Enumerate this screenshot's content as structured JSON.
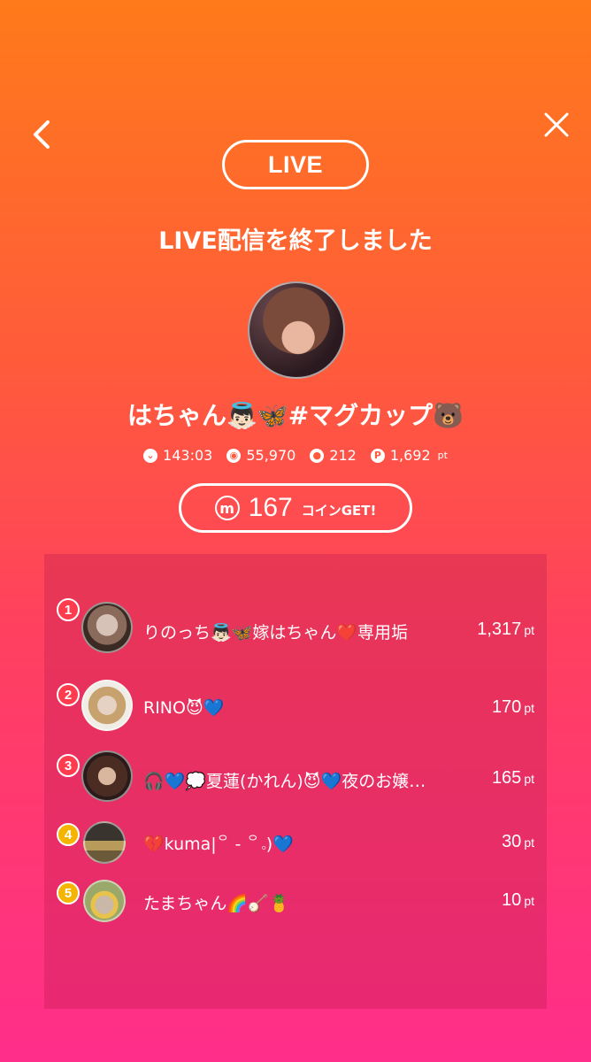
{
  "nav": {
    "back_icon": "chevron-left-icon",
    "close_icon": "close-icon"
  },
  "live_badge": "LIVE",
  "title": "LIVE配信を終了しました",
  "streamer": {
    "name": "はちゃん👼🏻🦋#マグカップ🐻"
  },
  "stats": [
    {
      "icon": "duration-icon",
      "value": "143:03",
      "unit": ""
    },
    {
      "icon": "viewers-icon",
      "value": "55,970",
      "unit": ""
    },
    {
      "icon": "comment-icon",
      "value": "212",
      "unit": ""
    },
    {
      "icon": "point-icon",
      "value": "1,692",
      "unit": "pt"
    }
  ],
  "coins": {
    "amount": "167",
    "label": "コインGET!",
    "icon_letter": "m"
  },
  "ranking": [
    {
      "rank": "1",
      "name": "りのっち👼🏻🦋嫁はちゃん❤️専用垢",
      "points": "1,317",
      "unit": "pt",
      "badge_color": "#ff3b4e"
    },
    {
      "rank": "2",
      "name": "RINO😈💙",
      "points": "170",
      "unit": "pt",
      "badge_color": "#ff3b4e"
    },
    {
      "rank": "3",
      "name": "🎧💙💭夏蓮(かれん)😈💙夜のお嬢…",
      "points": "165",
      "unit": "pt",
      "badge_color": "#ff3b4e"
    },
    {
      "rank": "4",
      "name": "💔kuma|꒪ - ꒪｡)💙",
      "points": "30",
      "unit": "pt",
      "badge_color": "#f5b400"
    },
    {
      "rank": "5",
      "name": "たまちゃん🌈🪕🍍",
      "points": "10",
      "unit": "pt",
      "badge_color": "#f5b400"
    }
  ]
}
